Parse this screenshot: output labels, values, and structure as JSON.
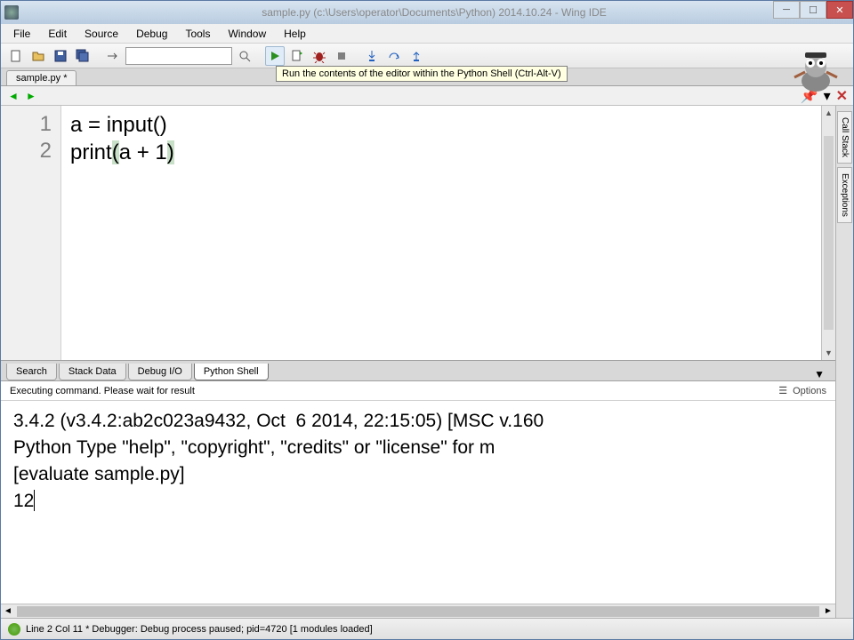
{
  "window": {
    "title": "sample.py (c:\\Users\\operator\\Documents\\Python) 2014.10.24 - Wing IDE"
  },
  "menu": {
    "file": "File",
    "edit": "Edit",
    "source": "Source",
    "debug": "Debug",
    "tools": "Tools",
    "window": "Window",
    "help": "Help"
  },
  "toolbar": {
    "search_placeholder": ""
  },
  "tooltip": "Run the contents of the editor within the Python Shell (Ctrl-Alt-V)",
  "tabs": {
    "file": "sample.py *"
  },
  "editor": {
    "lines": {
      "1": "1",
      "2": "2"
    },
    "code": {
      "line1_a": "a ",
      "line1_eq": "= ",
      "line1_input": "input",
      "line1_paren": "()",
      "line2_print": "print",
      "line2_open": "(",
      "line2_a": "a ",
      "line2_plus": "+ ",
      "line2_num": "1",
      "line2_close": ")"
    }
  },
  "right_rail": {
    "call_stack": "Call Stack",
    "exceptions": "Exceptions"
  },
  "bottom_tabs": {
    "search": "Search",
    "stack_data": "Stack Data",
    "debug_io": "Debug I/O",
    "python_shell": "Python Shell"
  },
  "shell": {
    "status": "Executing command.  Please wait for result",
    "options": "Options",
    "line1": "3.4.2 (v3.4.2:ab2c023a9432, Oct  6 2014, 22:15:05) [MSC v.160",
    "line2": "Python Type \"help\", \"copyright\", \"credits\" or \"license\" for m",
    "line3": "[evaluate sample.py]",
    "line4": "12"
  },
  "statusbar": {
    "text": "Line 2 Col 11 * Debugger: Debug process paused; pid=4720 [1 modules loaded]"
  }
}
